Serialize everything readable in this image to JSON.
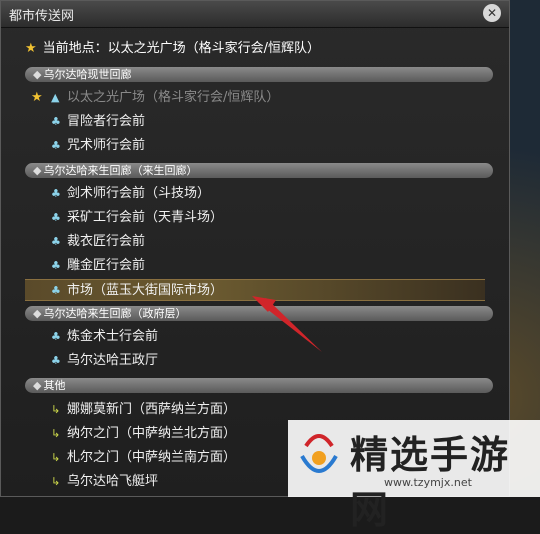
{
  "window": {
    "title": "都市传送网",
    "close_icon": "gear-close-icon"
  },
  "current": {
    "label": "当前地点：以太之光广场（格斗家行会/恒辉队）"
  },
  "sections": [
    {
      "label": "乌尔达哈现世回廊",
      "items": [
        {
          "label": "以太之光广场（格斗家行会/恒辉队）",
          "fav": true,
          "dim": true,
          "icon": "aetheryte-icon"
        },
        {
          "label": "冒险者行会前",
          "icon": "aetheryte-small-icon"
        },
        {
          "label": "咒术师行会前",
          "icon": "aetheryte-small-icon"
        }
      ]
    },
    {
      "label": "乌尔达哈来生回廊（来生回廊）",
      "items": [
        {
          "label": "剑术师行会前（斗技场）",
          "icon": "aetheryte-small-icon"
        },
        {
          "label": "采矿工行会前（天青斗场）",
          "icon": "aetheryte-small-icon"
        },
        {
          "label": "裁衣匠行会前",
          "icon": "aetheryte-small-icon"
        },
        {
          "label": "雕金匠行会前",
          "icon": "aetheryte-small-icon"
        },
        {
          "label": "市场（蓝玉大街国际市场）",
          "icon": "aetheryte-small-icon",
          "highlight": true
        }
      ]
    },
    {
      "label": "乌尔达哈来生回廊（政府层）",
      "items": [
        {
          "label": "炼金术士行会前",
          "icon": "aetheryte-small-icon"
        },
        {
          "label": "乌尔达哈王政厅",
          "icon": "aetheryte-small-icon"
        }
      ]
    },
    {
      "label": "其他",
      "items": [
        {
          "label": "娜娜莫新门（西萨纳兰方面）",
          "icon": "gate-icon"
        },
        {
          "label": "纳尔之门（中萨纳兰北方面）",
          "icon": "gate-icon"
        },
        {
          "label": "札尔之门（中萨纳兰南方面）",
          "icon": "gate-icon"
        },
        {
          "label": "乌尔达哈飞艇坪",
          "icon": "gate-icon"
        }
      ]
    }
  ],
  "watermark": {
    "brand": "精选手游网",
    "url": "www.tzymjx.net"
  },
  "colors": {
    "highlight": "#6b5a30",
    "arrow": "#d0252a",
    "star": "#f1c232",
    "aetheryte": "#8cd3ea"
  }
}
